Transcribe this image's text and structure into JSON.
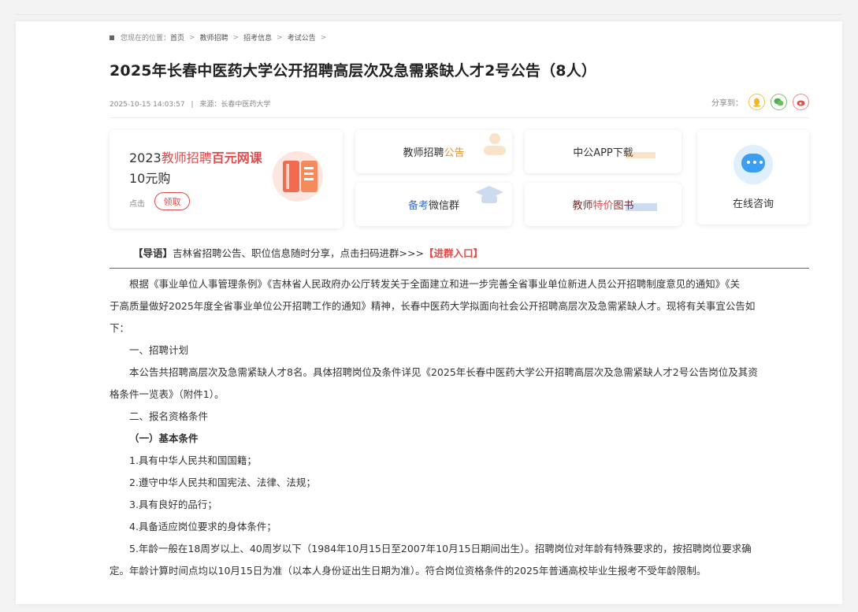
{
  "breadcrumb": {
    "label": "您现在的位置：",
    "items": [
      "首页",
      "教师招聘",
      "招考信息",
      "考试公告"
    ],
    "separator": ">"
  },
  "article": {
    "title": "2025年长春中医药大学公开招聘高层次及急需紧缺人才2号公告（8人）",
    "datetime": "2025-10-15 14:03:57",
    "meta_sep": "|",
    "source": "来源：长春中医药大学"
  },
  "share": {
    "label": "分享到：",
    "icons": [
      "qq-icon",
      "wechat-icon",
      "weibo-icon"
    ]
  },
  "promo": {
    "year": "2023",
    "part_red": "教师招聘",
    "part_bold": "百元网课",
    "price": "10元购",
    "click_label": "点击",
    "button": "领取"
  },
  "cards": {
    "a_main": "教师招聘",
    "a_accent": "公告",
    "b_main": "中公APP下载",
    "c_accent": "备考",
    "c_main": "微信群",
    "d_dark": "教师",
    "d_accent": "特价",
    "d_main": "图书",
    "consult": "在线咨询"
  },
  "guide": {
    "prefix": "【导语】",
    "text": "吉林省招聘公告、职位信息随时分享，点击扫码进群>>>",
    "link": "【进群入口】"
  },
  "body": {
    "p1_l1": "根据《事业单位人事管理条例》《吉林省人民政府办公厅转发关于全面建立和进一步完善全省事业单位新进人员公开招聘制度意见的通知》《关",
    "p1_l2": "于高质量做好2025年度全省事业单位公开招聘工作的通知》精神，长春中医药大学拟面向社会公开招聘高层次及急需紧缺人才。现将有关事宜公告如",
    "p1_l3": "下：",
    "h1": "一、招聘计划",
    "p2_l1": "本公告共招聘高层次及急需紧缺人才8名。具体招聘岗位及条件详见《2025年长春中医药大学公开招聘高层次及急需紧缺人才2号公告岗位及其资",
    "p2_l2": "格条件一览表》（附件1）。",
    "h2": "二、报名资格条件",
    "h3": "（一）基本条件",
    "c1": "1.具有中华人民共和国国籍；",
    "c2": "2.遵守中华人民共和国宪法、法律、法规；",
    "c3": "3.具有良好的品行；",
    "c4": "4.具备适应岗位要求的身体条件；",
    "c5_l1": "5.年龄一般在18周岁以上、40周岁以下（1984年10月15日至2007年10月15日期间出生）。招聘岗位对年龄有特殊要求的，按招聘岗位要求确",
    "c5_l2": "定。年龄计算时间点均以10月15日为准（以本人身份证出生日期为准）。符合岗位资格条件的2025年普通高校毕业生报考不受年龄限制。"
  }
}
